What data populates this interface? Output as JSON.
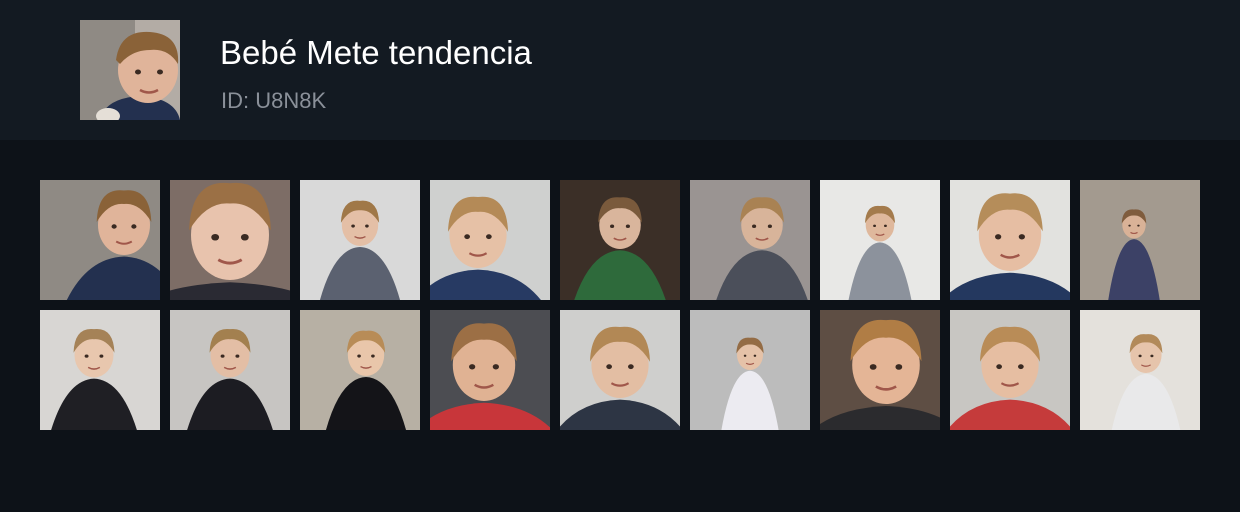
{
  "profile": {
    "name": "Bebé Mete tendencia",
    "id_label": "ID: U8N8K",
    "avatar_icon": "baby-face-photo"
  },
  "palette": {
    "page_bg": "#0d1218",
    "header_bg": "#131a22",
    "title_color": "#ffffff",
    "subtitle_color": "#8a9099"
  },
  "gallery": {
    "items": [
      {
        "bg": "#8f8a84",
        "skin": "#e0b49a",
        "hair": "#8a6238",
        "shirt": "#23304f",
        "face_scale": 1.0,
        "cx": 0.7
      },
      {
        "bg": "#7d6d66",
        "skin": "#e8c3ad",
        "hair": "#9b7045",
        "shirt": "#2a2a33",
        "face_scale": 1.5,
        "cx": 0.5
      },
      {
        "bg": "#d9d9d9",
        "skin": "#e4bfa6",
        "hair": "#a07848",
        "shirt": "#5b6170",
        "face_scale": 0.7,
        "cx": 0.5
      },
      {
        "bg": "#cfd0cf",
        "skin": "#e6c1a6",
        "hair": "#b48a57",
        "shirt": "#273a63",
        "face_scale": 1.1,
        "cx": 0.4
      },
      {
        "bg": "#3b2f27",
        "skin": "#d9b59c",
        "hair": "#7a5a3c",
        "shirt": "#2e6a3b",
        "face_scale": 0.8,
        "cx": 0.5
      },
      {
        "bg": "#9a9492",
        "skin": "#d8b49a",
        "hair": "#a98253",
        "shirt": "#4b4f5a",
        "face_scale": 0.8,
        "cx": 0.6
      },
      {
        "bg": "#e8e8e6",
        "skin": "#dfb89c",
        "hair": "#a47b4c",
        "shirt": "#8c929c",
        "face_scale": 0.55,
        "cx": 0.5
      },
      {
        "bg": "#e2e2df",
        "skin": "#e6bea3",
        "hair": "#b58d5a",
        "shirt": "#24385f",
        "face_scale": 1.2,
        "cx": 0.5
      },
      {
        "bg": "#a39a8f",
        "skin": "#d9b297",
        "hair": "#7f5c3d",
        "shirt": "#3c4166",
        "face_scale": 0.45,
        "cx": 0.45
      },
      {
        "bg": "#d8d6d3",
        "skin": "#e8c7ae",
        "hair": "#a58257",
        "shirt": "#1f1f24",
        "face_scale": 0.75,
        "cx": 0.45
      },
      {
        "bg": "#c7c5c2",
        "skin": "#e3bea5",
        "hair": "#a3804f",
        "shirt": "#1c1c22",
        "face_scale": 0.75,
        "cx": 0.5
      },
      {
        "bg": "#b7b0a4",
        "skin": "#e9c6aa",
        "hair": "#b88c57",
        "shirt": "#141418",
        "face_scale": 0.7,
        "cx": 0.55
      },
      {
        "bg": "#4c4d52",
        "skin": "#e0b293",
        "hair": "#9c6f45",
        "shirt": "#c8363a",
        "face_scale": 1.2,
        "cx": 0.45
      },
      {
        "bg": "#cfcfcd",
        "skin": "#e3bea3",
        "hair": "#b28855",
        "shirt": "#2d3544",
        "face_scale": 1.1,
        "cx": 0.5
      },
      {
        "bg": "#bcbcbc",
        "skin": "#e5c2a8",
        "hair": "#946c45",
        "shirt": "#ecebf1",
        "face_scale": 0.5,
        "cx": 0.5
      },
      {
        "bg": "#5e4e44",
        "skin": "#e4b596",
        "hair": "#b07d45",
        "shirt": "#2b2b2e",
        "face_scale": 1.3,
        "cx": 0.55
      },
      {
        "bg": "#c8c6c2",
        "skin": "#e6bea2",
        "hair": "#b98c57",
        "shirt": "#c53b3b",
        "face_scale": 1.1,
        "cx": 0.5
      },
      {
        "bg": "#e4e1dc",
        "skin": "#e6c4ab",
        "hair": "#b28a5a",
        "shirt": "#e9e9ea",
        "face_scale": 0.6,
        "cx": 0.55
      }
    ]
  }
}
